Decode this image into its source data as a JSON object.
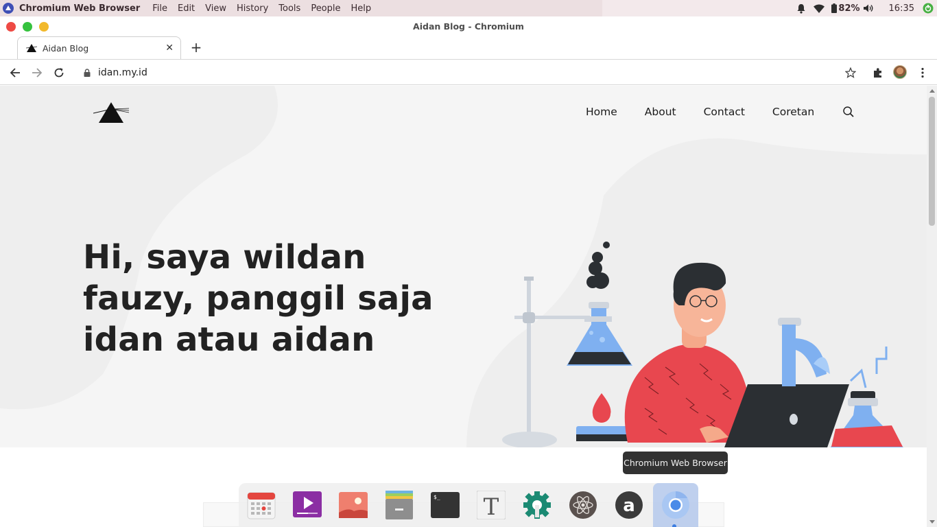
{
  "system_menubar": {
    "app_name": "Chromium Web Browser",
    "menus": [
      {
        "label": "File"
      },
      {
        "label": "Edit"
      },
      {
        "label": "View"
      },
      {
        "label": "History"
      },
      {
        "label": "Tools"
      },
      {
        "label": "People"
      },
      {
        "label": "Help"
      }
    ],
    "battery": "82%",
    "clock": "16:35",
    "tray_icons": [
      "bell-icon",
      "wifi-icon",
      "battery-icon",
      "volume-icon",
      "power-icon"
    ]
  },
  "window": {
    "title": "Aidan Blog - Chromium"
  },
  "tabs": [
    {
      "title": "Aidan Blog",
      "favicon": "triangle-logo-icon"
    }
  ],
  "toolbar": {
    "url": "idan.my.id"
  },
  "site": {
    "nav": [
      {
        "label": "Home"
      },
      {
        "label": "About"
      },
      {
        "label": "Contact"
      },
      {
        "label": "Coretan"
      }
    ],
    "hero_text": "Hi, saya wildan fauzy, panggil saja idan atau aidan"
  },
  "tooltip": {
    "text": "Chromium Web Browser"
  },
  "dock": {
    "apps": [
      {
        "name": "calendar-icon"
      },
      {
        "name": "video-player-icon"
      },
      {
        "name": "photos-icon"
      },
      {
        "name": "file-manager-icon"
      },
      {
        "name": "terminal-icon"
      },
      {
        "name": "text-editor-icon"
      },
      {
        "name": "settings-icon"
      },
      {
        "name": "atom-icon"
      },
      {
        "name": "appcenter-icon"
      },
      {
        "name": "chromium-icon"
      }
    ]
  },
  "colors": {
    "menubar_bg": "#ecdfe1",
    "page_bg": "#f5f5f5",
    "tooltip_bg": "#323232",
    "accent_flask": "#7fb0f0",
    "shirt_red": "#e8474f"
  }
}
